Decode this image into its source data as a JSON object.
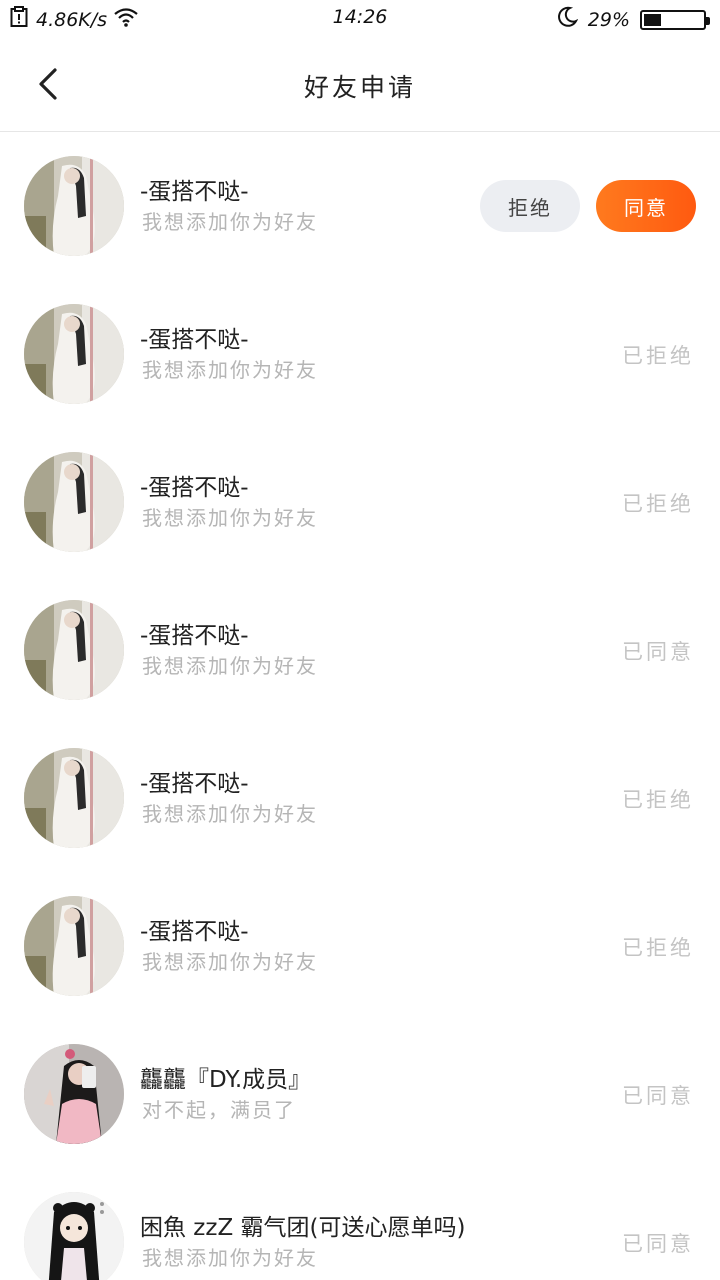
{
  "status_bar": {
    "speed": "4.86K/s",
    "time": "14:26",
    "battery": "29%",
    "battery_level": 0.29
  },
  "header": {
    "title": "好友申请"
  },
  "requests": [
    {
      "name": "-蛋搭不哒-",
      "message": "我想添加你为好友",
      "status": "",
      "reject_label": "拒绝",
      "accept_label": "同意"
    },
    {
      "name": "-蛋搭不哒-",
      "message": "我想添加你为好友",
      "status": "已拒绝"
    },
    {
      "name": "-蛋搭不哒-",
      "message": "我想添加你为好友",
      "status": "已拒绝"
    },
    {
      "name": "-蛋搭不哒-",
      "message": "我想添加你为好友",
      "status": "已同意"
    },
    {
      "name": "-蛋搭不哒-",
      "message": "我想添加你为好友",
      "status": "已拒绝"
    },
    {
      "name": "-蛋搭不哒-",
      "message": "我想添加你为好友",
      "status": "已拒绝"
    },
    {
      "name": "龘龘『DY.成员』",
      "message": "对不起，满员了",
      "status": "已同意"
    },
    {
      "name": "困魚 zzZ 霸气团(可送心愿单吗)",
      "message": "我想添加你为好友",
      "status": "已同意"
    }
  ],
  "colors": {
    "accent": "#ff6a14",
    "reject_bg": "#eceef2",
    "muted_text": "#c4c4c4"
  }
}
